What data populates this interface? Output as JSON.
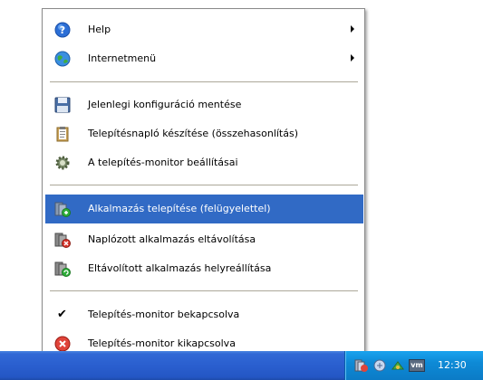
{
  "menu": {
    "items": [
      {
        "label": "Help",
        "icon": "help-icon",
        "submenu": true
      },
      {
        "label": "Internetmenü",
        "icon": "globe-icon",
        "submenu": true
      },
      {
        "label": "Jelenlegi konfiguráció mentése",
        "icon": "floppy-disk-icon"
      },
      {
        "label": "Telepítésnapló készítése (összehasonlítás)",
        "icon": "clipboard-icon"
      },
      {
        "label": "A telepítés-monitor beállításai",
        "icon": "gear-icon"
      },
      {
        "label": "Alkalmazás telepítése (felügyelettel)",
        "icon": "install-app-icon",
        "selected": true
      },
      {
        "label": "Naplózott alkalmazás eltávolítása",
        "icon": "uninstall-app-icon"
      },
      {
        "label": "Eltávolított alkalmazás helyreállítása",
        "icon": "restore-app-icon"
      },
      {
        "label": "Telepítés-monitor bekapcsolva",
        "icon": "checkmark-icon",
        "checked": true
      },
      {
        "label": "Telepítés-monitor kikapcsolva",
        "icon": "red-x-icon"
      }
    ]
  },
  "taskbar": {
    "clock": "12:30",
    "tray_icons": [
      "tray-install-monitor-icon",
      "tray-network-icon",
      "tray-connection-icon",
      "tray-vm-icon"
    ],
    "vm_label": "vm"
  },
  "colors": {
    "selection": "#316ac5",
    "taskbar": "#2a5fcf",
    "tray": "#0e8ad6"
  }
}
